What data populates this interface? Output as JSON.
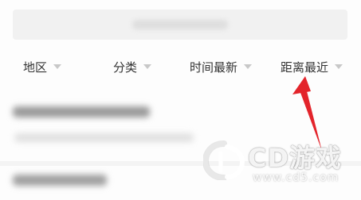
{
  "filters": [
    {
      "label": "地区",
      "icon": "caret-down-icon"
    },
    {
      "label": "分类",
      "icon": "caret-down-icon"
    },
    {
      "label": "时间最新",
      "icon": "caret-down-icon"
    },
    {
      "label": "距离最近",
      "icon": "caret-down-icon"
    }
  ],
  "annotation": {
    "icon": "red-arrow-icon",
    "color": "#e3242b"
  },
  "watermark": {
    "brand": "CD游戏",
    "url": "www.cd5.com"
  },
  "colors": {
    "filter_text": "#333333",
    "caret": "#c8c8c8",
    "search_bg": "#f1f1f1"
  }
}
